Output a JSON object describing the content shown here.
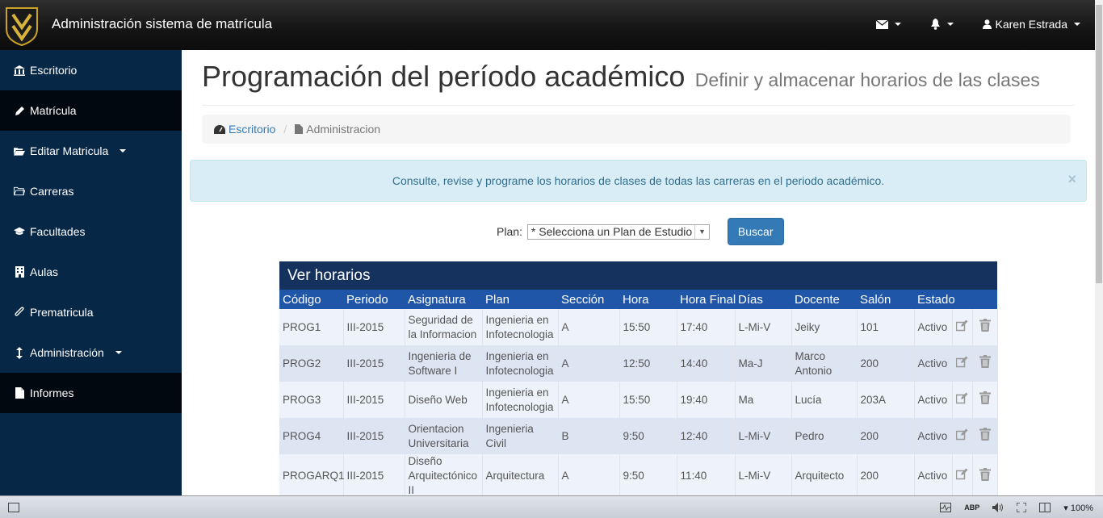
{
  "navbar": {
    "brand": "Administración sistema de matrícula",
    "user_name": "Karen Estrada"
  },
  "sidebar": {
    "items": [
      {
        "icon": "bank-icon",
        "label": "Escritorio"
      },
      {
        "icon": "pencil-icon",
        "label": "Matrícula"
      },
      {
        "icon": "folder-open-icon",
        "label": "Editar Matricula"
      },
      {
        "icon": "folder-icon",
        "label": "Carreras"
      },
      {
        "icon": "graduation-cap-icon",
        "label": "Facultades"
      },
      {
        "icon": "building-icon",
        "label": "Aulas"
      },
      {
        "icon": "paperclip-icon",
        "label": "Prematricula"
      },
      {
        "icon": "arrows-vertical-icon",
        "label": "Administración"
      },
      {
        "icon": "file-icon",
        "label": "Informes"
      }
    ]
  },
  "header": {
    "title": "Programación del período académico",
    "subtitle": "Definir y almacenar horarios de las clases"
  },
  "breadcrumb": {
    "home": "Escritorio",
    "current": "Administracion"
  },
  "alert": {
    "text": "Consulte, revise y programe los horarios de clases de todas las carreras en el periodo académico.",
    "close": "×"
  },
  "filter": {
    "label": "Plan:",
    "selected": "* Selecciona un Plan de Estudio",
    "button": "Buscar"
  },
  "table": {
    "title": "Ver horarios",
    "columns": [
      "Código",
      "Periodo",
      "Asignatura",
      "Plan",
      "Sección",
      "Hora",
      "Hora Final",
      "Días",
      "Docente",
      "Salón",
      "Estado"
    ],
    "rows": [
      [
        "PROG1",
        "III-2015",
        "Seguridad de la Informacion",
        "Ingenieria en Infotecnologia",
        "A",
        "15:50",
        "17:40",
        "L-Mi-V",
        "Jeiky",
        "101",
        "Activo"
      ],
      [
        "PROG2",
        "III-2015",
        "Ingenieria de Software I",
        "Ingenieria en Infotecnologia",
        "A",
        "12:50",
        "14:40",
        "Ma-J",
        "Marco Antonio",
        "200",
        "Activo"
      ],
      [
        "PROG3",
        "III-2015",
        "Diseño Web",
        "Ingenieria en Infotecnologia",
        "A",
        "15:50",
        "19:40",
        "Ma",
        "Lucía",
        "203A",
        "Activo"
      ],
      [
        "PROG4",
        "III-2015",
        "Orientacion Universitaria",
        "Ingenieria Civil",
        "B",
        "9:50",
        "12:40",
        "L-Mi-V",
        "Pedro",
        "200",
        "Activo"
      ],
      [
        "PROGARQ1",
        "III-2015",
        "Diseño Arquitectónico II",
        "Arquitectura",
        "A",
        "9:50",
        "11:40",
        "L-Mi-V",
        "Arquitecto",
        "200",
        "Activo"
      ]
    ]
  },
  "statusbar": {
    "zoom": "100%",
    "adblock": "ABP"
  }
}
